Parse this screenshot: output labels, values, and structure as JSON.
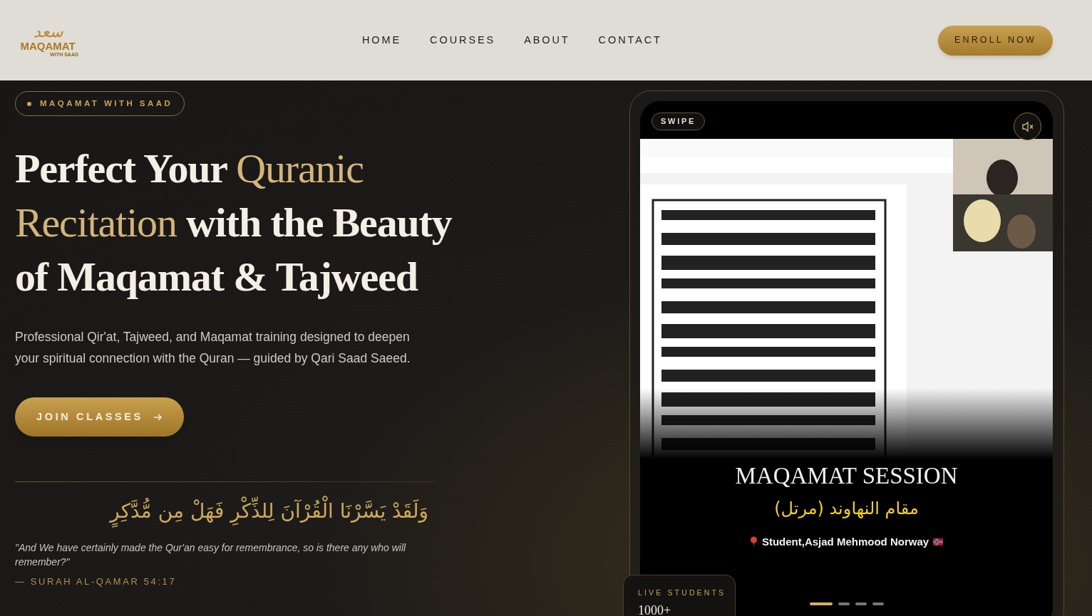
{
  "logo": {
    "arabic": "سعد",
    "title": "MAQAMAT",
    "subtitle": "WITH SAAD"
  },
  "nav": [
    {
      "label": "HOME"
    },
    {
      "label": "COURSES"
    },
    {
      "label": "ABOUT"
    },
    {
      "label": "CONTACT"
    }
  ],
  "enroll_button": "ENROLL NOW",
  "hero": {
    "badge": "MAQAMAT WITH SAAD",
    "heading": [
      {
        "text": "Perfect Your ",
        "accent": false
      },
      {
        "text": "Quranic Recitation",
        "accent": true
      },
      {
        "text": " with the Beauty of Maqamat & Tajweed",
        "accent": false
      }
    ],
    "description": "Professional Qir'at, Tajweed, and Maqamat training designed to deepen your spiritual connection with the Quran — guided by Qari Saad Saeed.",
    "join_button": "JOIN CLASSES",
    "verse_arabic": "وَلَقَدْ يَسَّرْنَا الْقُرْآنَ لِلذِّكْرِ فَهَلْ مِن مُّدَّكِرٍ",
    "verse_translation": "\"And We have certainly made the Qur'an easy for remembrance, so is there any who will remember?\"",
    "verse_reference": "— SURAH AL-QAMAR 54:17"
  },
  "video": {
    "badge": "SWIPE",
    "muted": true,
    "kind": "picture",
    "title": "MAQAMAT SESSION",
    "subtitle": "مقام النهاوند (مرتل)",
    "caption": "Student,Asjad Mehmood Norway",
    "slides": [
      {
        "selected": true
      },
      {
        "selected": false
      },
      {
        "selected": false
      },
      {
        "selected": false
      }
    ]
  },
  "stats": {
    "label": "LIVE STUDENTS",
    "value": "1000+"
  }
}
